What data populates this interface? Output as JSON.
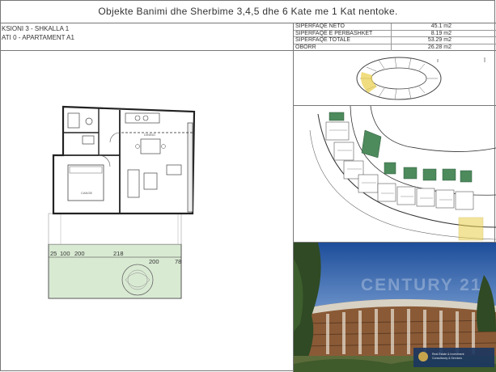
{
  "header": {
    "title": "Objekte Banimi dhe Sherbime 3,4,5 dhe 6 Kate me 1 Kat nentoke."
  },
  "unit_info": {
    "section": "KSIONI 3 - SHKALLA 1",
    "floor_apartment": "ATI 0 - APARTAMENT A1"
  },
  "areas": [
    {
      "label": "SIPERFAQE NETO",
      "value": "45.1 m2"
    },
    {
      "label": "SIPERFAQE E PERBASHKET",
      "value": "8.19 m2"
    },
    {
      "label": "SIPERFAQE TOTALE",
      "value": "53.29 m2"
    },
    {
      "label": "OBORR",
      "value": "26.28 m2"
    }
  ],
  "floor_plan": {
    "dimensions": [
      "25",
      "100",
      "200",
      "218",
      "200",
      "78"
    ],
    "room_labels": [
      "CANGE",
      "DINING"
    ],
    "colors": {
      "garden": "#d9ead3",
      "wall": "#222222",
      "window": "#555555"
    }
  },
  "site_plan": {
    "colors": {
      "green_units": "#4d8a5c",
      "highlight": "#e9cf4a",
      "outline": "#333333"
    }
  },
  "photo": {
    "watermark": "CENTURY 21",
    "logo_line1": "Real Estate & Investment",
    "logo_line2": "Consultancy & Services",
    "colors": {
      "sky_top": "#1d4d9a",
      "sky_bottom": "#b7cbe6",
      "building": "#8a5a36",
      "trees": "#2f4a24"
    }
  }
}
